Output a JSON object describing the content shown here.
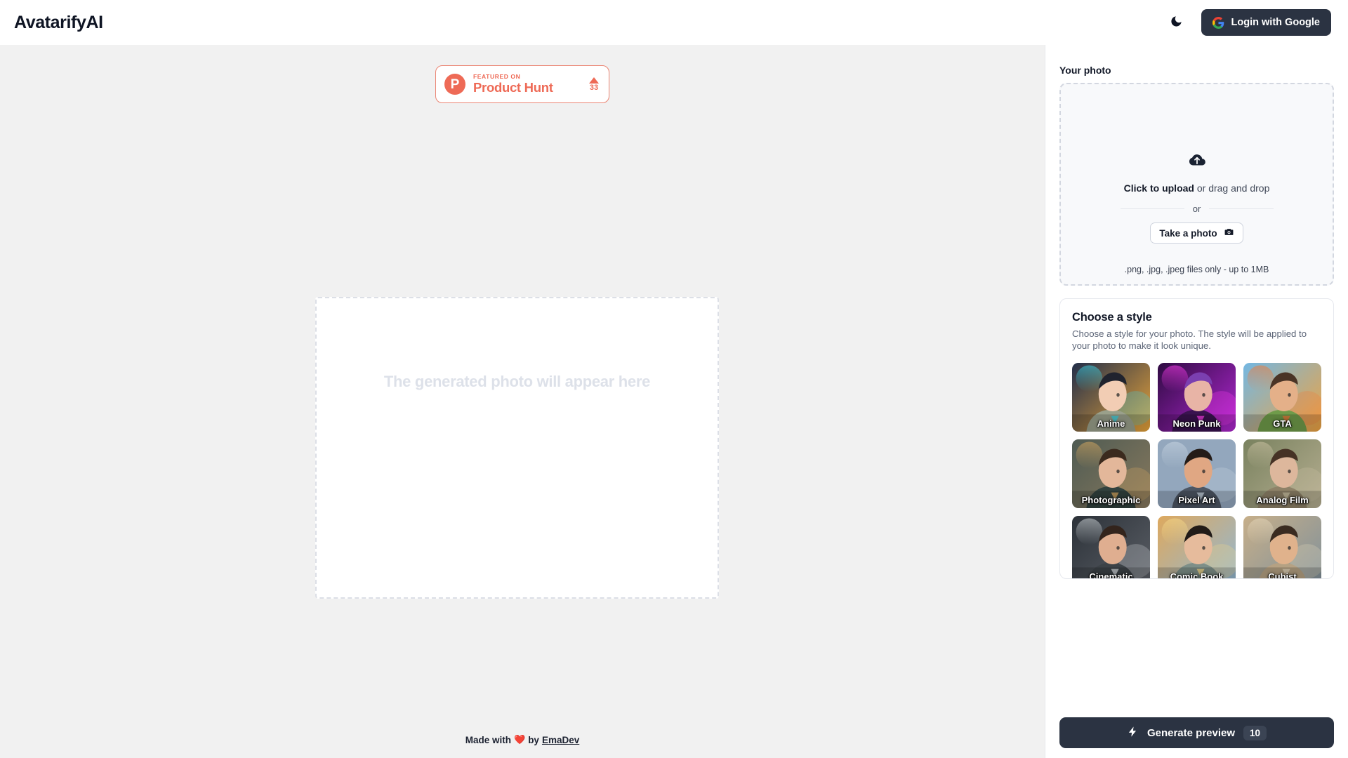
{
  "header": {
    "brand": "AvatarifyAI",
    "theme_toggle_icon": "moon-icon",
    "login_label": "Login with Google",
    "login_icon": "google-logo-icon"
  },
  "product_hunt": {
    "logo_letter": "P",
    "kicker": "FEATURED ON",
    "name": "Product Hunt",
    "upvote_icon": "upvote-triangle-icon",
    "votes": "33"
  },
  "result": {
    "placeholder": "The generated photo will appear here"
  },
  "footer": {
    "prefix": "Made with ",
    "heart": "❤️",
    "middle": "by ",
    "author": "EmaDev"
  },
  "upload": {
    "label": "Your photo",
    "icon": "cloud-upload-icon",
    "cta_bold": "Click to upload",
    "cta_rest": " or drag and drop",
    "or": "or",
    "take_photo_label": "Take a photo",
    "take_photo_icon": "camera-icon",
    "hint": ".png, .jpg, .jpeg files only - up to 1MB"
  },
  "styles": {
    "title": "Choose a style",
    "description": "Choose a style for your photo. The style will be applied to your photo to make it look unique.",
    "items": [
      {
        "label": "Anime",
        "bg_a": "#1b2a4a",
        "bg_b": "#f0a93a",
        "accent": "#3fd1e0",
        "skin": "#f2cdb4",
        "hair": "#20232e",
        "cloth": "#9aa08b"
      },
      {
        "label": "Neon Punk",
        "bg_a": "#2a0a3d",
        "bg_b": "#b528d6",
        "accent": "#ff3df0",
        "skin": "#e8b4a6",
        "hair": "#7b3fb0",
        "cloth": "#3a1350"
      },
      {
        "label": "GTA",
        "bg_a": "#6fb8e8",
        "bg_b": "#f4a23a",
        "accent": "#ef7b3a",
        "skin": "#e4b089",
        "hair": "#4a3426",
        "cloth": "#6f9b4a"
      },
      {
        "label": "Photographic",
        "bg_a": "#4d5a52",
        "bg_b": "#8a7a5e",
        "accent": "#d6a860",
        "skin": "#e3b79a",
        "hair": "#3b2a1e",
        "cloth": "#32423f"
      },
      {
        "label": "Pixel Art",
        "bg_a": "#93a7bd",
        "bg_b": "#93a7bd",
        "accent": "#c9d6e2",
        "skin": "#e0a783",
        "hair": "#241c18",
        "cloth": "#4d5663"
      },
      {
        "label": "Analog Film",
        "bg_a": "#77805d",
        "bg_b": "#b8b093",
        "accent": "#cdc3a4",
        "skin": "#ddb79c",
        "hair": "#463225",
        "cloth": "#8e8268"
      },
      {
        "label": "Cinematic",
        "bg_a": "#2a3037",
        "bg_b": "#5d6168",
        "accent": "#cfd5d8",
        "skin": "#dfae90",
        "hair": "#33241c",
        "cloth": "#3c4247"
      },
      {
        "label": "Comic Book",
        "bg_a": "#e0a85a",
        "bg_b": "#8fb8d8",
        "accent": "#f5d98a",
        "skin": "#e6bb9c",
        "hair": "#211b18",
        "cloth": "#7e8f88"
      },
      {
        "label": "Cubist",
        "bg_a": "#c9b089",
        "bg_b": "#7d8f9b",
        "accent": "#e3d6bb",
        "skin": "#e0b28c",
        "hair": "#3a2b20",
        "cloth": "#b5a183"
      },
      {
        "label": "",
        "bg_a": "#8fb6d6",
        "bg_b": "#c7b49a",
        "accent": "#e8eef2",
        "skin": "#e2ab86",
        "hair": "#342620",
        "cloth": "#7e8f6a"
      },
      {
        "label": "",
        "bg_a": "#9fc6e4",
        "bg_b": "#e6eef5",
        "accent": "#ffffff",
        "skin": "#e5b492",
        "hair": "#4a362a",
        "cloth": "#cfc7b5"
      },
      {
        "label": "",
        "bg_a": "#101c3a",
        "bg_b": "#2c4a78",
        "accent": "#f3dc9a",
        "skin": "#e3b08d",
        "hair": "#3b2a20",
        "cloth": "#d8d2c4"
      }
    ]
  },
  "generate": {
    "icon": "lightning-bolt-icon",
    "label": "Generate preview",
    "credits": "10"
  }
}
